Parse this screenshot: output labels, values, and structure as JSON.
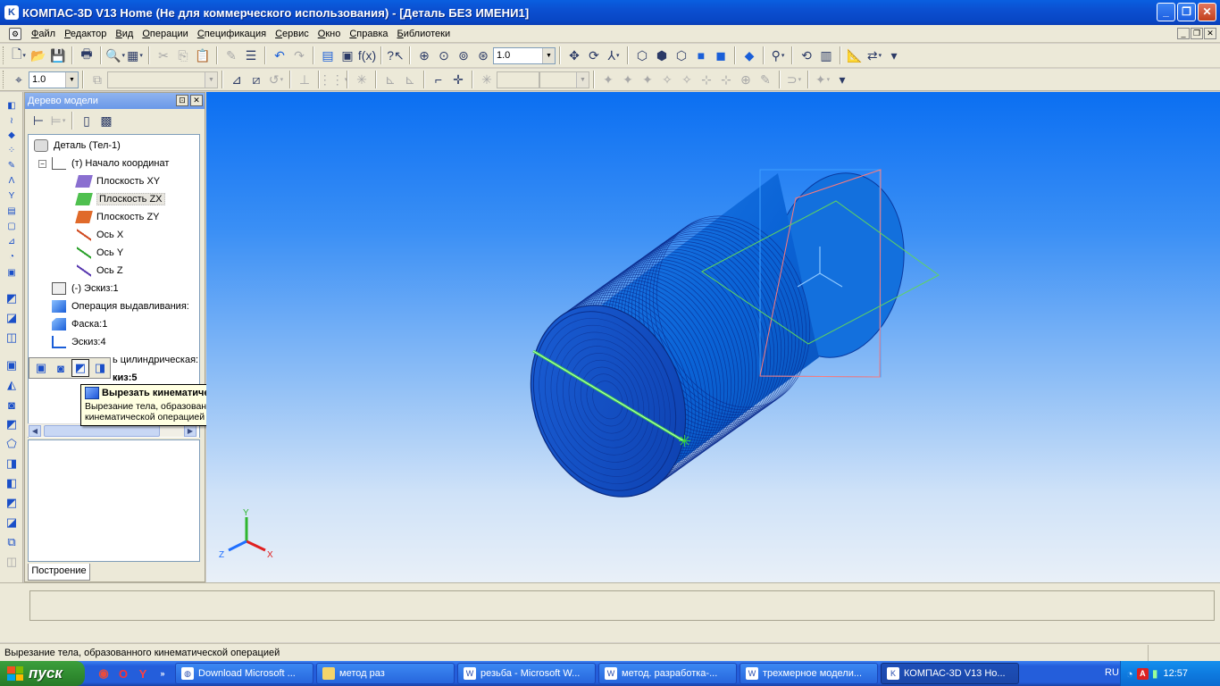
{
  "window": {
    "title": "КОМПАС-3D V13 Home (Не для коммерческого использования) - [Деталь БЕЗ ИМЕНИ1]",
    "app_icon": "K",
    "controls": [
      "_",
      "❐",
      "✕"
    ]
  },
  "menu": {
    "items": [
      "Файл",
      "Редактор",
      "Вид",
      "Операции",
      "Спецификация",
      "Сервис",
      "Окно",
      "Справка",
      "Библиотеки"
    ]
  },
  "toolbar1": {
    "zoom_value": "1.0"
  },
  "toolbar2": {
    "step_value": "1.0",
    "empty_combo": ""
  },
  "tree_panel": {
    "title": "Дерево модели",
    "nodes": [
      {
        "label": "Деталь (Тел-1)"
      },
      {
        "label": "(т) Начало координат"
      },
      {
        "label": "Плоскость XY"
      },
      {
        "label": "Плоскость ZX"
      },
      {
        "label": "Плоскость ZY"
      },
      {
        "label": "Ось X"
      },
      {
        "label": "Ось Y"
      },
      {
        "label": "Ось Z"
      },
      {
        "label": "(-)  Эскиз:1"
      },
      {
        "label": "Операция выдавливания:"
      },
      {
        "label": "Фаска:1"
      },
      {
        "label": "Эскиз:4"
      },
      {
        "label": "ь цилиндрическая:"
      },
      {
        "label": "киз:5"
      }
    ],
    "tab_label": "Построение"
  },
  "tooltip": {
    "title": "Вырезать кинематически",
    "description": "Вырезание тела, образованного кинематической операцией"
  },
  "viewport": {
    "axis_labels": {
      "x": "X",
      "y": "Y",
      "z": "Z"
    },
    "colors": {
      "body": "#0a63d6",
      "ends": "#0f3fb5",
      "plane_xy": "#5fd45f",
      "plane_zx": "#ff7a7a",
      "plane_zy": "#3d9fff"
    }
  },
  "status": {
    "message": "Вырезание тела, образованного кинематической операцией"
  },
  "taskbar": {
    "start_label": "пуск",
    "tasks": [
      {
        "label": "Download Microsoft ...",
        "icon": "firefox-icon"
      },
      {
        "label": "метод раз",
        "icon": "folder-icon"
      },
      {
        "label": "резьба - Microsoft W...",
        "icon": "word-icon"
      },
      {
        "label": "метод. разработка-...",
        "icon": "word-icon"
      },
      {
        "label": "трехмерное модели...",
        "icon": "word-icon"
      },
      {
        "label": "КОМПАС-3D V13 Ho...",
        "icon": "kompas-icon"
      }
    ],
    "language": "RU",
    "clock": "12:57"
  }
}
